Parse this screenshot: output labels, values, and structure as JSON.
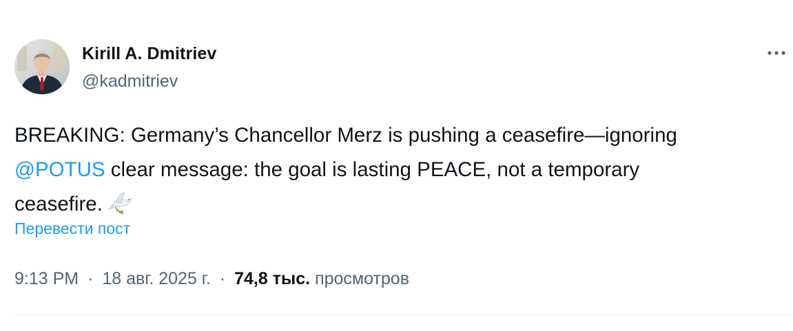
{
  "author": {
    "display_name": "Kirill A. Dmitriev",
    "handle": "@kadmitriev",
    "avatar_icon": "profile-photo"
  },
  "menu": {
    "icon": "more-dots-icon"
  },
  "tweet": {
    "line1": "BREAKING: Germany’s Chancellor Merz is pushing a ceasefire—ignoring",
    "mention": "@POTUS",
    "line2_rest": " clear message: the goal is lasting PEACE, not a temporary",
    "line3": "ceasefire.",
    "emoji_icon": "dove-icon"
  },
  "translate_label": "Перевести пост",
  "meta": {
    "time": "9:13 PM",
    "separator": "·",
    "date": "18 авг. 2025 г.",
    "views_count": "74,8 тыс.",
    "views_label": "просмотров"
  },
  "colors": {
    "link": "#1d9bf0",
    "text": "#0f1419",
    "secondary": "#536471",
    "divider": "#eff3f4"
  }
}
